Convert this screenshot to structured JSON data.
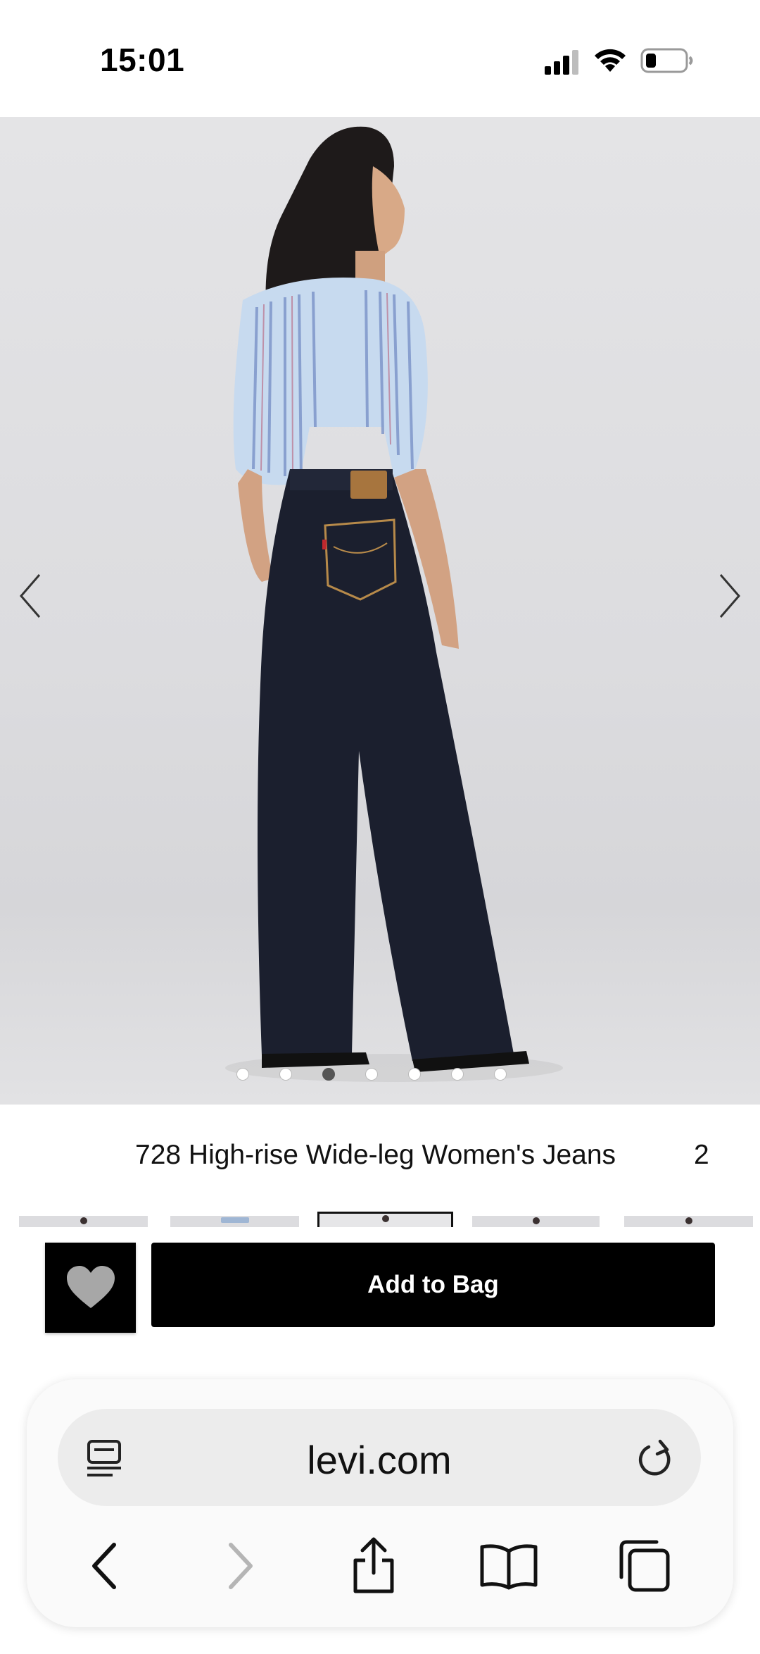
{
  "status_bar": {
    "time": "15:01",
    "icons": [
      "signal-icon",
      "wifi-icon",
      "battery-icon"
    ]
  },
  "product": {
    "title": "728 High-rise Wide-leg Women's Jeans",
    "title_overflow": "2",
    "image_dots": 7,
    "active_dot": 3,
    "thumbnails": 5,
    "selected_thumbnail": 3
  },
  "actions": {
    "wishlist_icon": "heart-icon",
    "add_to_bag_label": "Add to Bag"
  },
  "browser": {
    "url": "levi.com",
    "icons": [
      "reader-icon",
      "reload-icon",
      "back-icon",
      "forward-icon",
      "share-icon",
      "bookmarks-icon",
      "tabs-icon"
    ]
  },
  "colors": {
    "button_bg": "#000000",
    "button_text": "#ffffff",
    "image_bg": "#dcdcdf",
    "denim": "#1b1f2e"
  }
}
